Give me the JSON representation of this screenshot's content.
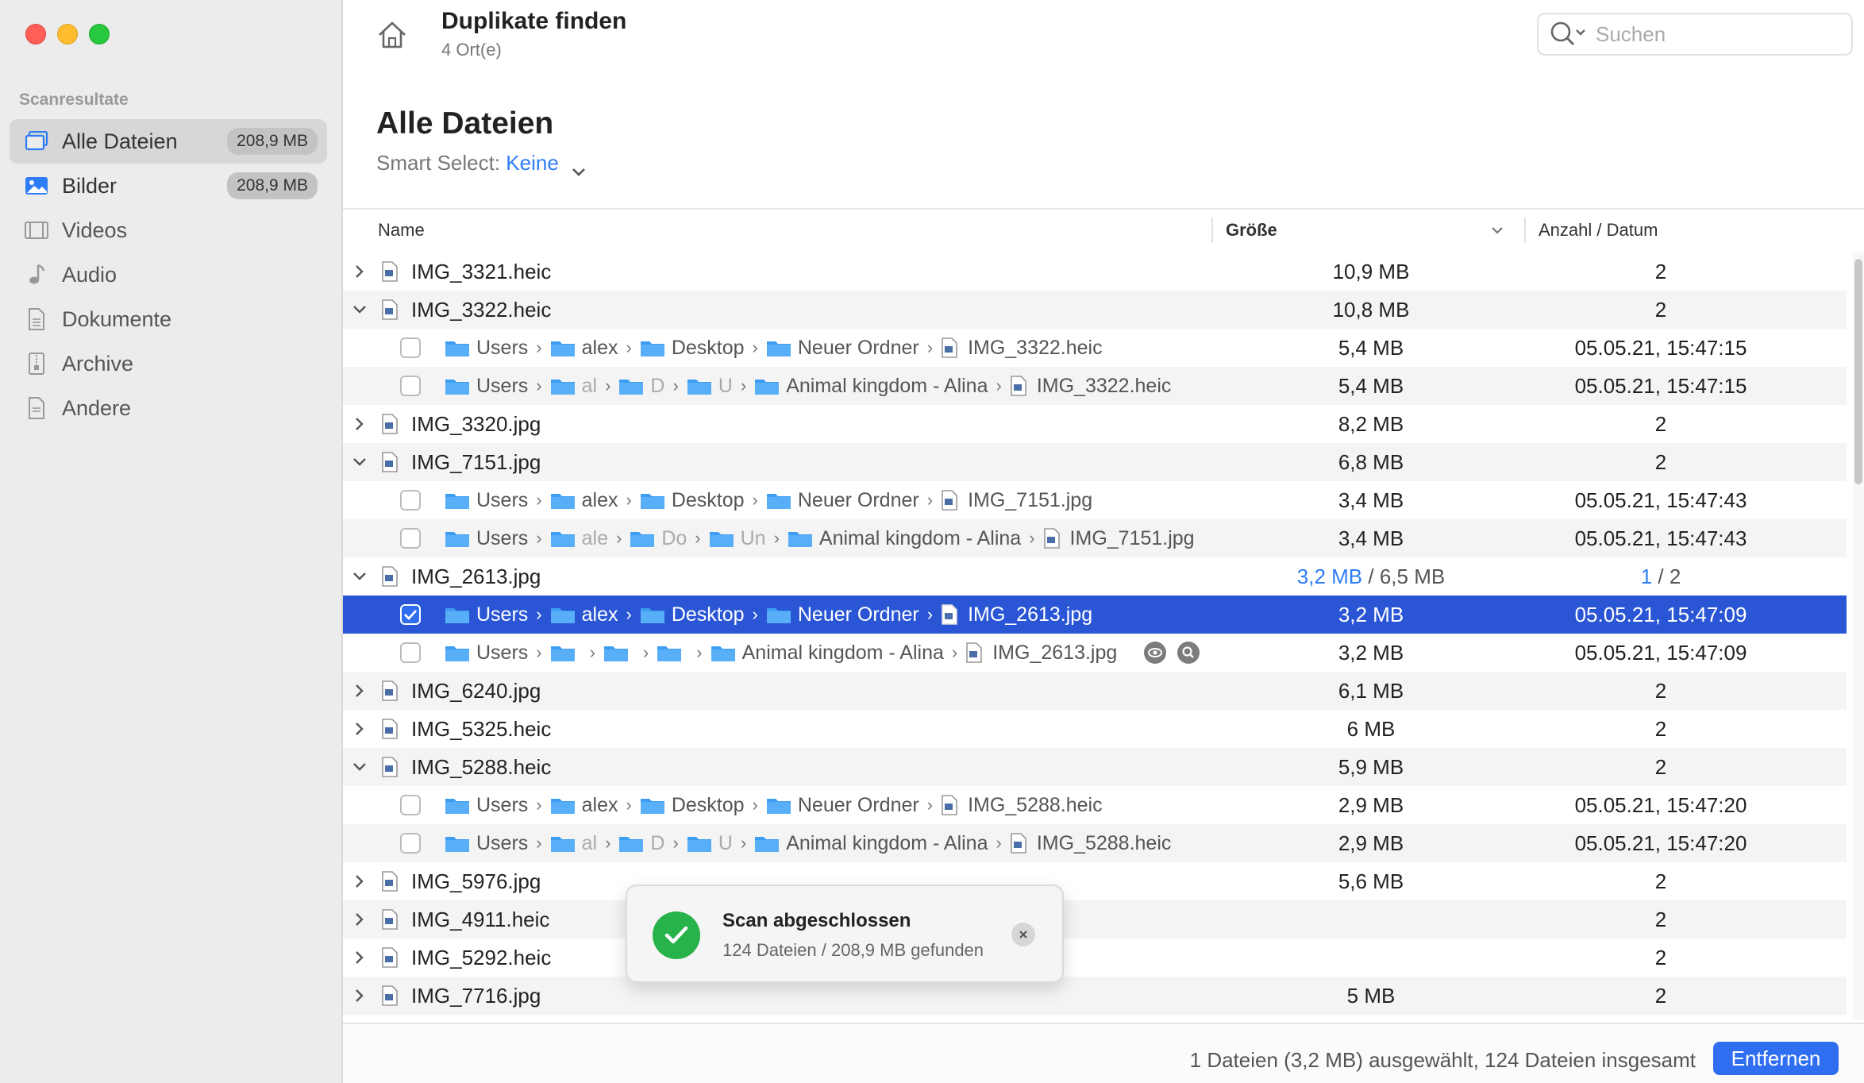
{
  "sidebar": {
    "section": "Scanresultate",
    "items": [
      {
        "label": "Alle Dateien",
        "badge": "208,9 MB",
        "icon": "stack-icon"
      },
      {
        "label": "Bilder",
        "badge": "208,9 MB",
        "icon": "image-icon"
      },
      {
        "label": "Videos",
        "icon": "film-icon"
      },
      {
        "label": "Audio",
        "icon": "music-note-icon"
      },
      {
        "label": "Dokumente",
        "icon": "document-icon"
      },
      {
        "label": "Archive",
        "icon": "archive-icon"
      },
      {
        "label": "Andere",
        "icon": "document-icon"
      }
    ]
  },
  "header": {
    "title": "Duplikate finden",
    "subtitle": "4 Ort(e)",
    "search_placeholder": "Suchen"
  },
  "main": {
    "heading": "Alle Dateien",
    "smart_label": "Smart Select:",
    "smart_value": "Keine"
  },
  "table": {
    "headers": {
      "name": "Name",
      "size": "Größe",
      "count": "Anzahl / Datum"
    },
    "r1": {
      "name": "IMG_3321.heic",
      "size": "10,9 MB",
      "count": "2"
    },
    "r2": {
      "name": "IMG_3322.heic",
      "size": "10,8 MB",
      "count": "2"
    },
    "r2a": {
      "p1": "Users",
      "p2": "alex",
      "p3": "Desktop",
      "p4": "Neuer Ordner",
      "file": "IMG_3322.heic",
      "size": "5,4 MB",
      "date": "05.05.21, 15:47:15"
    },
    "r2b": {
      "p1": "Users",
      "p2": "al",
      "p3": "D",
      "p4": "U",
      "p5": "Animal kingdom - Alina",
      "file": "IMG_3322.heic",
      "size": "5,4 MB",
      "date": "05.05.21, 15:47:15"
    },
    "r3": {
      "name": "IMG_3320.jpg",
      "size": "8,2 MB",
      "count": "2"
    },
    "r4": {
      "name": "IMG_7151.jpg",
      "size": "6,8 MB",
      "count": "2"
    },
    "r4a": {
      "p1": "Users",
      "p2": "alex",
      "p3": "Desktop",
      "p4": "Neuer Ordner",
      "file": "IMG_7151.jpg",
      "size": "3,4 MB",
      "date": "05.05.21, 15:47:43"
    },
    "r4b": {
      "p1": "Users",
      "p2": "ale",
      "p3": "Do",
      "p4": "Un",
      "p5": "Animal kingdom - Alina",
      "file": "IMG_7151.jpg",
      "size": "3,4 MB",
      "date": "05.05.21, 15:47:43"
    },
    "r5": {
      "name": "IMG_2613.jpg",
      "size_sel": "3,2 MB",
      "size_rest": "/ 6,5 MB",
      "count_sel": "1",
      "count_rest": "/ 2"
    },
    "r5a": {
      "p1": "Users",
      "p2": "alex",
      "p3": "Desktop",
      "p4": "Neuer Ordner",
      "file": "IMG_2613.jpg",
      "size": "3,2 MB",
      "date": "05.05.21, 15:47:09"
    },
    "r5b": {
      "p1": "Users",
      "p5": "Animal kingdom - Alina",
      "file": "IMG_2613.jpg",
      "size": "3,2 MB",
      "date": "05.05.21, 15:47:09"
    },
    "r6": {
      "name": "IMG_6240.jpg",
      "size": "6,1 MB",
      "count": "2"
    },
    "r7": {
      "name": "IMG_5325.heic",
      "size": "6 MB",
      "count": "2"
    },
    "r8": {
      "name": "IMG_5288.heic",
      "size": "5,9 MB",
      "count": "2"
    },
    "r8a": {
      "p1": "Users",
      "p2": "alex",
      "p3": "Desktop",
      "p4": "Neuer Ordner",
      "file": "IMG_5288.heic",
      "size": "2,9 MB",
      "date": "05.05.21, 15:47:20"
    },
    "r8b": {
      "p1": "Users",
      "p2": "al",
      "p3": "D",
      "p4": "U",
      "p5": "Animal kingdom - Alina",
      "file": "IMG_5288.heic",
      "size": "2,9 MB",
      "date": "05.05.21, 15:47:20"
    },
    "r9": {
      "name": "IMG_5976.jpg",
      "size": "5,6 MB",
      "count": "2"
    },
    "r10": {
      "name": "IMG_4911.heic",
      "count": "2"
    },
    "r11": {
      "name": "IMG_5292.heic",
      "count": "2"
    },
    "r12": {
      "name": "IMG_7716.jpg",
      "size": "5 MB",
      "count": "2"
    }
  },
  "toast": {
    "title": "Scan abgeschlossen",
    "message": "124 Dateien / 208,9 MB gefunden"
  },
  "footer": {
    "status": "1 Dateien (3,2 MB) ausgewählt, 124 Dateien insgesamt",
    "remove_label": "Entfernen"
  },
  "colors": {
    "accent": "#2f6ef0",
    "selection": "#2a56d6",
    "success": "#27b24a"
  }
}
